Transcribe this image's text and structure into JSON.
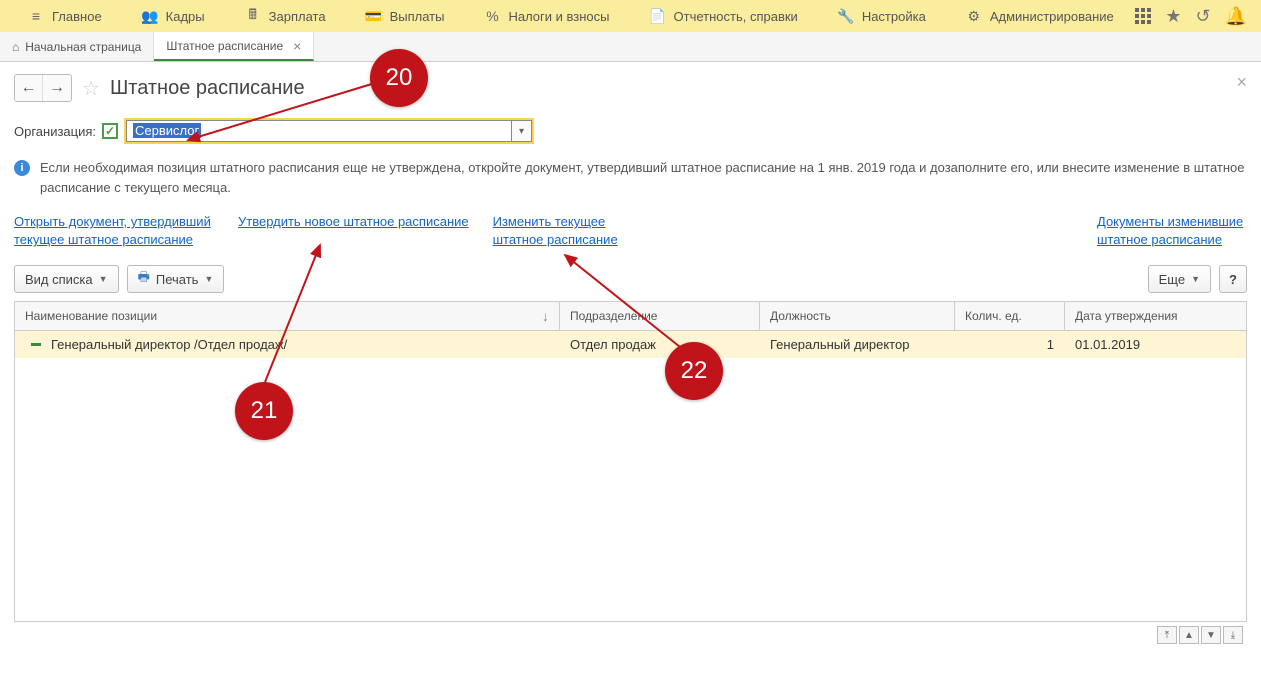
{
  "top_menu": {
    "items": [
      {
        "icon": "menu-icon",
        "label": "Главное"
      },
      {
        "icon": "people-icon",
        "label": "Кадры"
      },
      {
        "icon": "calc-icon",
        "label": "Зарплата"
      },
      {
        "icon": "wallet-icon",
        "label": "Выплаты"
      },
      {
        "icon": "percent-icon",
        "label": "Налоги и взносы"
      },
      {
        "icon": "report-icon",
        "label": "Отчетность, справки"
      },
      {
        "icon": "wrench-icon",
        "label": "Настройка"
      },
      {
        "icon": "gear-icon",
        "label": "Администрирование"
      }
    ]
  },
  "tabs": [
    {
      "icon": "home-icon",
      "label": "Начальная страница",
      "closable": false
    },
    {
      "icon": "",
      "label": "Штатное расписание",
      "closable": true,
      "active": true
    }
  ],
  "page": {
    "title": "Штатное расписание",
    "org_label": "Организация:",
    "org_value": "Сервислог",
    "info_text": "Если необходимая позиция штатного расписания еще не утверждена, откройте документ, утвердивший штатное расписание на 1 янв. 2019 года и дозаполните его, или внесите изменение в штатное расписание с текущего месяца."
  },
  "links": {
    "open_doc": "Открыть документ, утвердивший текущее штатное расписание",
    "approve_new": "Утвердить новое штатное расписание",
    "change_current": "Изменить текущее штатное расписание",
    "docs_changed": "Документы изменившие штатное расписание"
  },
  "toolbar": {
    "view_list": "Вид списка",
    "print": "Печать",
    "more": "Еще",
    "help": "?"
  },
  "table": {
    "columns": {
      "name": "Наименование позиции",
      "dept": "Подразделение",
      "position": "Должность",
      "qty": "Колич. ед.",
      "date": "Дата утверждения"
    },
    "rows": [
      {
        "name": "Генеральный директор /Отдел продаж/",
        "dept": "Отдел продаж",
        "position": "Генеральный директор",
        "qty": "1",
        "date": "01.01.2019"
      }
    ]
  },
  "callouts": {
    "c20": "20",
    "c21": "21",
    "c22": "22"
  }
}
